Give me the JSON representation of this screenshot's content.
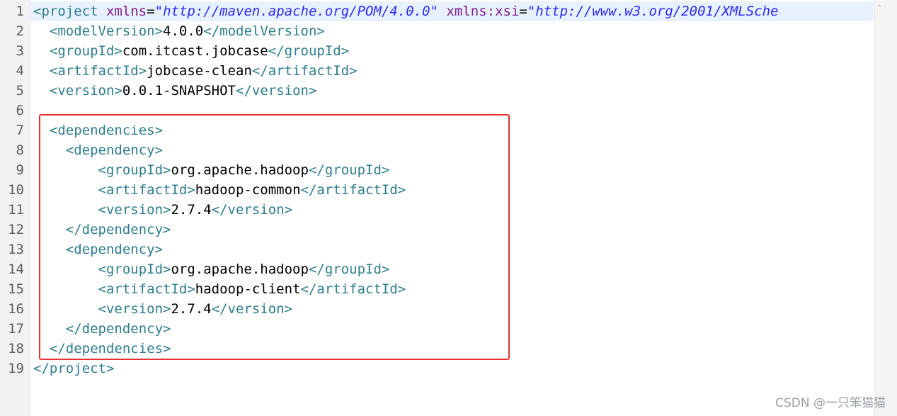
{
  "editor": {
    "line_numbers": [
      "1",
      "2",
      "3",
      "4",
      "5",
      "6",
      "7",
      "8",
      "9",
      "10",
      "11",
      "12",
      "13",
      "14",
      "15",
      "16",
      "17",
      "18",
      "19"
    ],
    "lines": {
      "l1": {
        "p1": "<project",
        "p2": " ",
        "p3": "xmlns",
        "p4": "=",
        "p5": "\"http://maven.apache.org/POM/4.0.0\"",
        "p6": " ",
        "p7": "xmlns:xsi",
        "p8": "=",
        "p9": "\"http://www.w3.org/2001/XMLSche"
      },
      "l2": {
        "indent": "  ",
        "open": "<modelVersion>",
        "text": "4.0.0",
        "close": "</modelVersion>"
      },
      "l3": {
        "indent": "  ",
        "open": "<groupId>",
        "text": "com.itcast.jobcase",
        "close": "</groupId>"
      },
      "l4": {
        "indent": "  ",
        "open": "<artifactId>",
        "text": "jobcase-clean",
        "close": "</artifactId>"
      },
      "l5": {
        "indent": "  ",
        "open": "<version>",
        "text": "0.0.1-SNAPSHOT",
        "close": "</version>"
      },
      "l7": {
        "indent": "  ",
        "open": "<dependencies>"
      },
      "l8": {
        "indent": "    ",
        "open": "<dependency>"
      },
      "l9": {
        "indent": "        ",
        "open": "<groupId>",
        "text": "org.apache.hadoop",
        "close": "</groupId>"
      },
      "l10": {
        "indent": "        ",
        "open": "<artifactId>",
        "text": "hadoop-common",
        "close": "</artifactId>"
      },
      "l11": {
        "indent": "        ",
        "open": "<version>",
        "text": "2.7.4",
        "close": "</version>"
      },
      "l12": {
        "indent": "    ",
        "close": "</dependency>"
      },
      "l13": {
        "indent": "    ",
        "open": "<dependency>"
      },
      "l14": {
        "indent": "        ",
        "open": "<groupId>",
        "text": "org.apache.hadoop",
        "close": "</groupId>"
      },
      "l15": {
        "indent": "        ",
        "open": "<artifactId>",
        "text": "hadoop-client",
        "close": "</artifactId>"
      },
      "l16": {
        "indent": "        ",
        "open": "<version>",
        "text": "2.7.4",
        "close": "</version>"
      },
      "l17": {
        "indent": "    ",
        "close": "</dependency>"
      },
      "l18": {
        "indent": "  ",
        "close": "</dependencies>"
      },
      "l19": {
        "close": "</project>"
      }
    }
  },
  "watermark": "CSDN @一只笨猫猫",
  "colors": {
    "tag": "#2e7d8c",
    "attribute": "#7f1c8c",
    "string": "#2a2aff",
    "highlight_box": "#e53333"
  },
  "icons": {
    "scroll_up": "chevron-up-icon"
  }
}
